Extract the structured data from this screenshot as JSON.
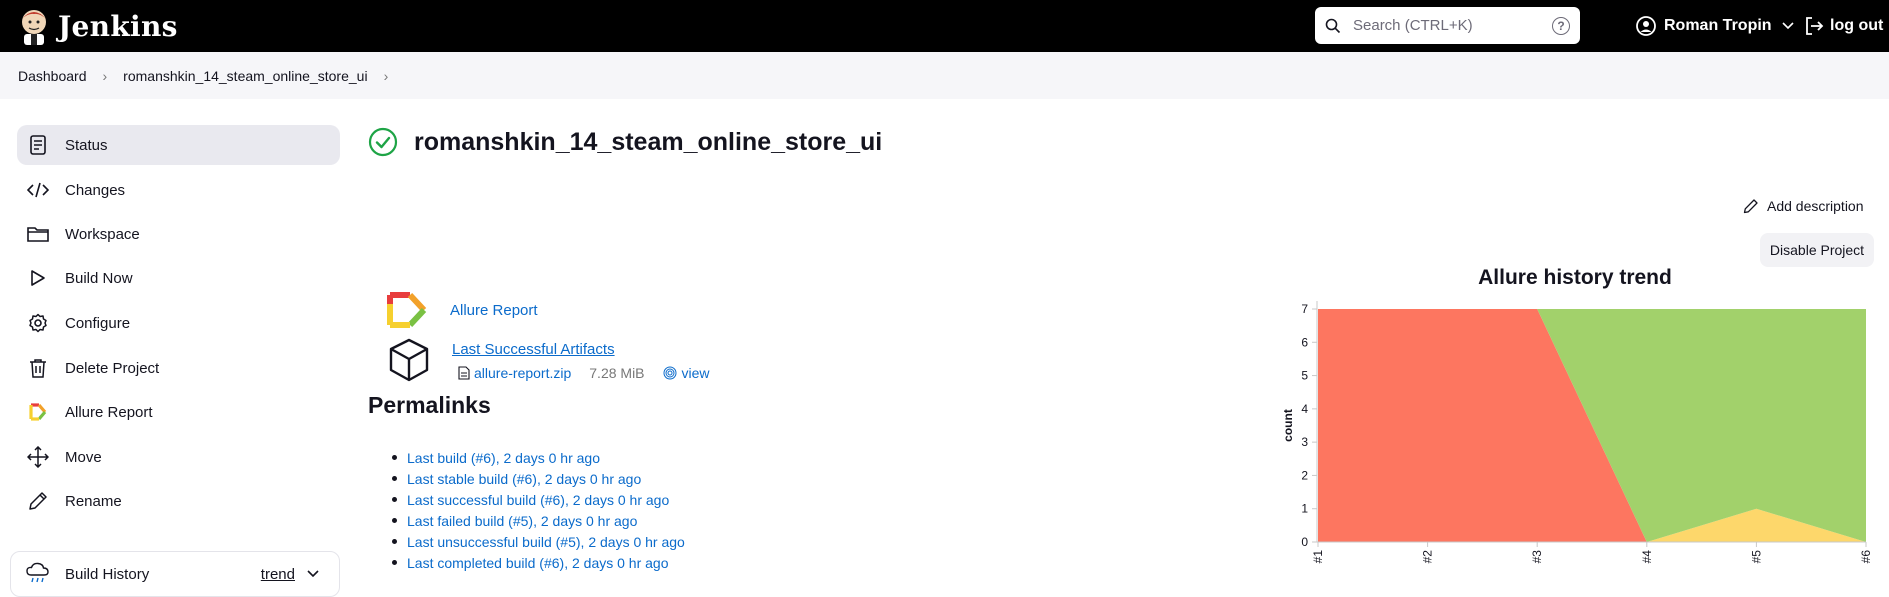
{
  "header": {
    "app_title": "Jenkins",
    "search_placeholder": "Search (CTRL+K)",
    "help_glyph": "?",
    "user_name": "Roman Tropin",
    "logout_label": "log out"
  },
  "breadcrumbs": [
    "Dashboard",
    "romanshkin_14_steam_online_store_ui"
  ],
  "sidebar": {
    "items": [
      {
        "label": "Status",
        "icon": "document-icon"
      },
      {
        "label": "Changes",
        "icon": "code-icon"
      },
      {
        "label": "Workspace",
        "icon": "folder-icon"
      },
      {
        "label": "Build Now",
        "icon": "play-icon"
      },
      {
        "label": "Configure",
        "icon": "gear-icon"
      },
      {
        "label": "Delete Project",
        "icon": "trash-icon"
      },
      {
        "label": "Allure Report",
        "icon": "allure-icon"
      },
      {
        "label": "Move",
        "icon": "move-icon"
      },
      {
        "label": "Rename",
        "icon": "pencil-icon"
      }
    ],
    "build_history": {
      "label": "Build History",
      "trend_label": "trend"
    }
  },
  "main": {
    "project_title": "romanshkin_14_steam_online_store_ui",
    "add_description": "Add description",
    "disable_project": "Disable Project",
    "allure_report_link": "Allure Report",
    "last_successful_artifacts": "Last Successful Artifacts",
    "artifact_file": "allure-report.zip",
    "artifact_size": "7.28 MiB",
    "artifact_view": "view",
    "permalinks_title": "Permalinks",
    "permalinks": [
      "Last build (#6), 2 days 0 hr ago",
      "Last stable build (#6), 2 days 0 hr ago",
      "Last successful build (#6), 2 days 0 hr ago",
      "Last failed build (#5), 2 days 0 hr ago",
      "Last unsuccessful build (#5), 2 days 0 hr ago",
      "Last completed build (#6), 2 days 0 hr ago"
    ]
  },
  "colors": {
    "accent_link": "#0b6bcb",
    "success_green": "#1ea446",
    "failed_red": "#fd7660",
    "passed_green": "#a2d16b",
    "broken_yellow": "#fdd76b"
  },
  "chart_data": {
    "type": "area",
    "title": "Allure history trend",
    "ylabel": "count",
    "x": [
      "#1",
      "#2",
      "#3",
      "#4",
      "#5",
      "#6"
    ],
    "ylim": [
      0,
      7
    ],
    "yticks": [
      0,
      1,
      2,
      3,
      4,
      5,
      6,
      7
    ],
    "series": [
      {
        "values": [
          0,
          0,
          0,
          0,
          1,
          0
        ],
        "color": "#fdd76b"
      },
      {
        "values": [
          7,
          7,
          7,
          0,
          0,
          0
        ],
        "color": "#fd7660"
      },
      {
        "values": [
          0,
          0,
          0,
          7,
          6,
          7
        ],
        "color": "#a2d16b"
      }
    ]
  }
}
